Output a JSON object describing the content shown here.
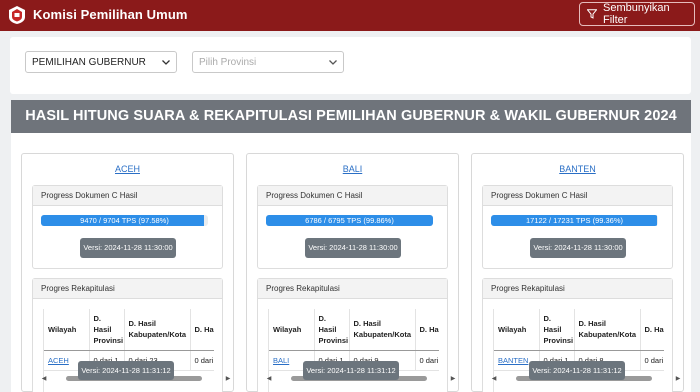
{
  "header": {
    "brand": "Komisi Pemilihan Umum",
    "logo_icon": "kpu-logo",
    "filter_button": "Sembunyikan Filter",
    "filter_icon": "funnel-icon",
    "background_color": "#8b1a1a"
  },
  "filters": {
    "election_type": "PEMILIHAN GUBERNUR",
    "province_placeholder": "Pilih Provinsi"
  },
  "page_title": "HASIL HITUNG SUARA & REKAPITULASI PEMILIHAN GUBERNUR & WAKIL GUBERNUR 2024",
  "provinces": [
    {
      "name": "ACEH",
      "doc_title": "Progress Dokumen C Hasil",
      "progress_text": "9470 / 9704 TPS (97.58%)",
      "progress_percent": 97.58,
      "doc_version": "Versi: 2024-11-28 11:30:00",
      "rekap_title": "Progres Rekapitulasi",
      "table_headers": [
        "Wilayah",
        "D. Hasil Provinsi",
        "D. Hasil Kabupaten/Kota",
        "D. Hasil Kecamatan"
      ],
      "table_row": [
        "ACEH",
        "0 dari 1",
        "0 dari 23",
        "0 dari"
      ],
      "rekap_version": "Versi: 2024-11-28 11:31:12"
    },
    {
      "name": "BALI",
      "doc_title": "Progress Dokumen C Hasil",
      "progress_text": "6786 / 6795 TPS (99.86%)",
      "progress_percent": 99.86,
      "doc_version": "Versi: 2024-11-28 11:30:00",
      "rekap_title": "Progres Rekapitulasi",
      "table_headers": [
        "Wilayah",
        "D. Hasil Provinsi",
        "D. Hasil Kabupaten/Kota",
        "D. Hasil Kecamatan"
      ],
      "table_row": [
        "BALI",
        "0 dari 1",
        "0 dari 9",
        "0 dari"
      ],
      "rekap_version": "Versi: 2024-11-28 11:31:12"
    },
    {
      "name": "BANTEN",
      "doc_title": "Progress Dokumen C Hasil",
      "progress_text": "17122 / 17231 TPS (99.36%)",
      "progress_percent": 99.36,
      "doc_version": "Versi: 2024-11-28 11:30:00",
      "rekap_title": "Progres Rekapitulasi",
      "table_headers": [
        "Wilayah",
        "D. Hasil Provinsi",
        "D. Hasil Kabupaten/Kota",
        "D. Hasil Kecamatan"
      ],
      "table_row": [
        "BANTEN",
        "0 dari 1",
        "0 dari 8",
        "0 dari"
      ],
      "rekap_version": "Versi: 2024-11-28 11:31:12"
    }
  ]
}
